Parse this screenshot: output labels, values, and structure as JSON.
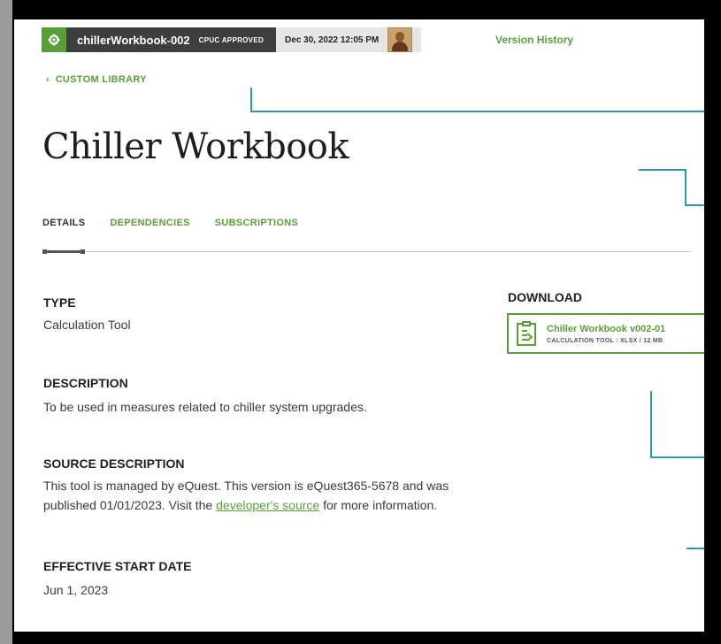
{
  "header": {
    "gear_icon": "gear-icon",
    "workbook_id": "chillerWorkbook-002",
    "badge": "CPUC APPROVED",
    "timestamp": "Dec 30, 2022 12:05 PM",
    "version_history": "Version History"
  },
  "breadcrumb": {
    "label": "CUSTOM LIBRARY",
    "icon": "chevron-left-icon"
  },
  "page": {
    "title": "Chiller Workbook"
  },
  "tabs": [
    {
      "label": "DETAILS",
      "active": true
    },
    {
      "label": "DEPENDENCIES",
      "active": false
    },
    {
      "label": "SUBSCRIPTIONS",
      "active": false
    }
  ],
  "details": {
    "type_label": "TYPE",
    "type_value": "Calculation Tool",
    "description_label": "DESCRIPTION",
    "description_value": "To be used in measures related to chiller system upgrades.",
    "source_label": "SOURCE DESCRIPTION",
    "source_line1": "This tool is managed by eQuest. This version is eQuest365-5678 and was",
    "source_line2_pre": "published 01/01/2023. Visit the ",
    "source_link": "developer's source",
    "source_line2_post": " for more information.",
    "start_label": "EFFECTIVE START DATE",
    "start_value": "Jun 1, 2023"
  },
  "download": {
    "label": "DOWNLOAD",
    "file_name": "Chiller Workbook v002-01",
    "file_meta": "CALCULATION TOOL : XLSX / 12 MB",
    "icon": "spreadsheet-file-icon"
  },
  "colors": {
    "accent": "#5a9e3a",
    "header_dark": "#3e3e3e",
    "connector": "#2f97a8"
  }
}
